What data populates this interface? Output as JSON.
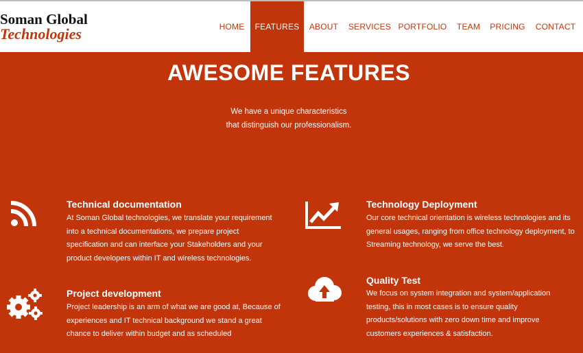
{
  "brand": {
    "line1": "Soman Global",
    "line2": "Technologies"
  },
  "nav": {
    "items": [
      {
        "label": "HOME"
      },
      {
        "label": "FEATURES"
      },
      {
        "label": "ABOUT"
      },
      {
        "label": "SERVICES"
      },
      {
        "label": "PORTFOLIO"
      },
      {
        "label": "TEAM"
      },
      {
        "label": "PRICING"
      },
      {
        "label": "CONTACT"
      }
    ],
    "active": "FEATURES"
  },
  "hero": {
    "title": "AWESOME FEATURES",
    "subtitle_line1": "We have a unique characteristics",
    "subtitle_line2": "that distinguish our professionalism."
  },
  "features": [
    {
      "icon": "rss-icon",
      "title": "Technical documentation",
      "lines": [
        "At Soman Global technologies, we translate your requirement",
        "into a technical documentations, we prepare project",
        "specification and can interface your Stakeholders and your",
        "product developers within IT and wireless technologies."
      ]
    },
    {
      "icon": "chart-growth-icon",
      "title": "Technology Deployment",
      "lines": [
        "Our core technical orientation is wireless technologies and its",
        "general usages, ranging from office technology deployment, to",
        "Streaming technology, we serve the best."
      ]
    },
    {
      "icon": "gears-icon",
      "title": "Project development",
      "lines": [
        "Project leadership is an arm of what we are good at, Because of",
        "experiences and IT technical background we stand a great",
        "chance to deliver within budget and as scheduled"
      ]
    },
    {
      "icon": "cloud-upload-icon",
      "title": "Quality Test",
      "lines": [
        "We focus on system integration and system/application",
        "testing, this in most cases is to ensure quality",
        "products/solutions with zero down time and improve",
        "customers experiences & satisfaction."
      ]
    }
  ],
  "colors": {
    "accent": "#c2350b",
    "header_bg": "#ffffff",
    "text_on_accent": "#ffffff"
  }
}
